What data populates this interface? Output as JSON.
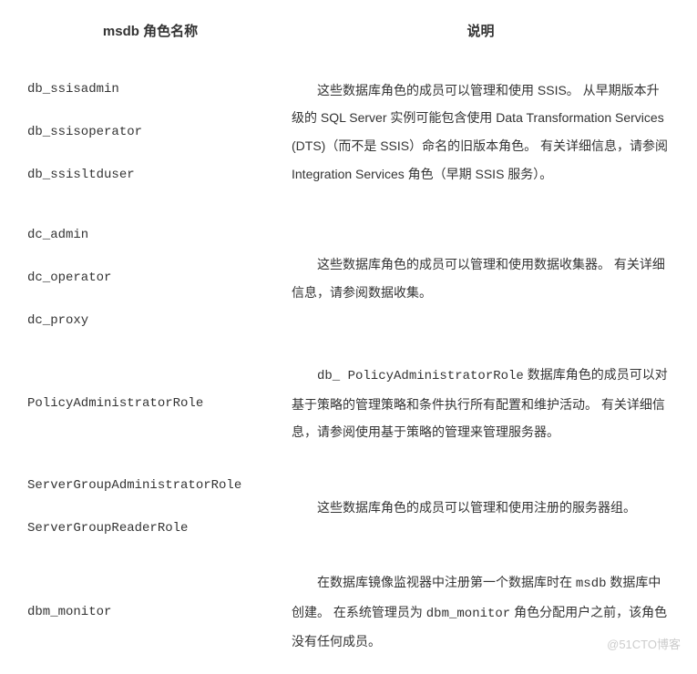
{
  "table": {
    "headers": {
      "role": "msdb 角色名称",
      "desc": "说明"
    },
    "rows": [
      {
        "roles": [
          "db_ssisadmin",
          "db_ssisoperator",
          "db_ssisltduser"
        ],
        "desc_parts": [
          "这些数据库角色的成员可以管理和使用 SSIS。 从早期版本升级的 SQL Server 实例可能包含使用 Data Transformation Services (DTS)（而不是 SSIS）命名的旧版本角色。 有关详细信息，请参阅 Integration Services 角色（早期 SSIS 服务）。"
        ]
      },
      {
        "roles": [
          "dc_admin",
          "dc_operator",
          "dc_proxy"
        ],
        "desc_parts": [
          "这些数据库角色的成员可以管理和使用数据收集器。 有关详细信息，请参阅数据收集。"
        ]
      },
      {
        "roles": [
          "PolicyAdministratorRole"
        ],
        "desc_prefix_mono": "db_ PolicyAdministratorRole",
        "desc_parts": [
          " 数据库角色的成员可以对基于策略的管理策略和条件执行所有配置和维护活动。 有关详细信息，请参阅使用基于策略的管理来管理服务器。"
        ]
      },
      {
        "roles": [
          "ServerGroupAdministratorRole",
          "ServerGroupReaderRole"
        ],
        "desc_parts": [
          "这些数据库角色的成员可以管理和使用注册的服务器组。"
        ]
      },
      {
        "roles": [
          "dbm_monitor"
        ],
        "desc_html_segments": [
          {
            "type": "text",
            "value": "在数据库镜像监视器中注册第一个数据库时在 "
          },
          {
            "type": "mono",
            "value": "msdb"
          },
          {
            "type": "text",
            "value": " 数据库中创建。 在系统管理员为 "
          },
          {
            "type": "mono",
            "value": "dbm_monitor"
          },
          {
            "type": "text",
            "value": " 角色分配用户之前，该角色没有任何成员。"
          }
        ]
      }
    ]
  },
  "watermark": "@51CTO博客"
}
